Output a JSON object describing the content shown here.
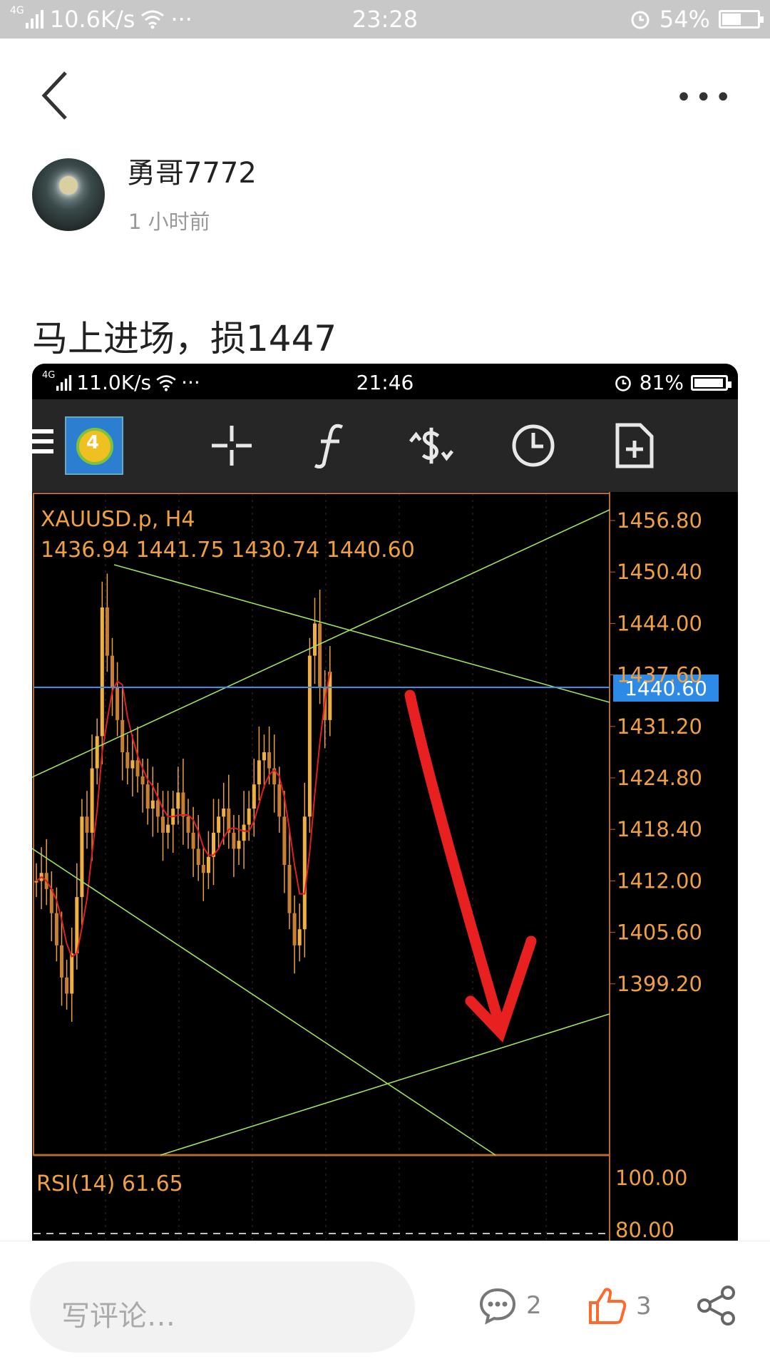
{
  "status_bar": {
    "network": "4G",
    "speed": "10.6K/s",
    "dots": "···",
    "time": "23:28",
    "battery": "54%"
  },
  "nav": {
    "more": "•••"
  },
  "post": {
    "username": "勇哥7772",
    "time_ago": "1 小时前",
    "text": "马上进场，损1447"
  },
  "screenshot": {
    "status_bar": {
      "network": "4G",
      "speed": "11.0K/s",
      "dots": "···",
      "time": "21:46",
      "battery": "81%"
    },
    "toolbar": {
      "logo_number": "4"
    },
    "chart_header": {
      "symbol": "XAUUSD.p, H4",
      "ohlc": "1436.94 1441.75 1430.74 1440.60"
    },
    "price_axis": [
      "1456.80",
      "1450.40",
      "1444.00",
      "1437.60",
      "1431.20",
      "1424.80",
      "1418.40",
      "1412.00",
      "1405.60",
      "1399.20"
    ],
    "current_price": "1440.60",
    "rsi": {
      "label": "RSI(14) 61.65",
      "axis": [
        "100.00",
        "80.00"
      ]
    }
  },
  "bottom_bar": {
    "comment_placeholder": "写评论…",
    "comments_count": "2",
    "likes_count": "3"
  },
  "colors": {
    "accent_orange": "#f0a030",
    "like_orange": "#ff6a2b",
    "chart_text": "#f0a040",
    "price_line": "#3a8eea",
    "trend_line": "#9ee060",
    "ma_line": "#e02020",
    "arrow": "#e82020"
  }
}
